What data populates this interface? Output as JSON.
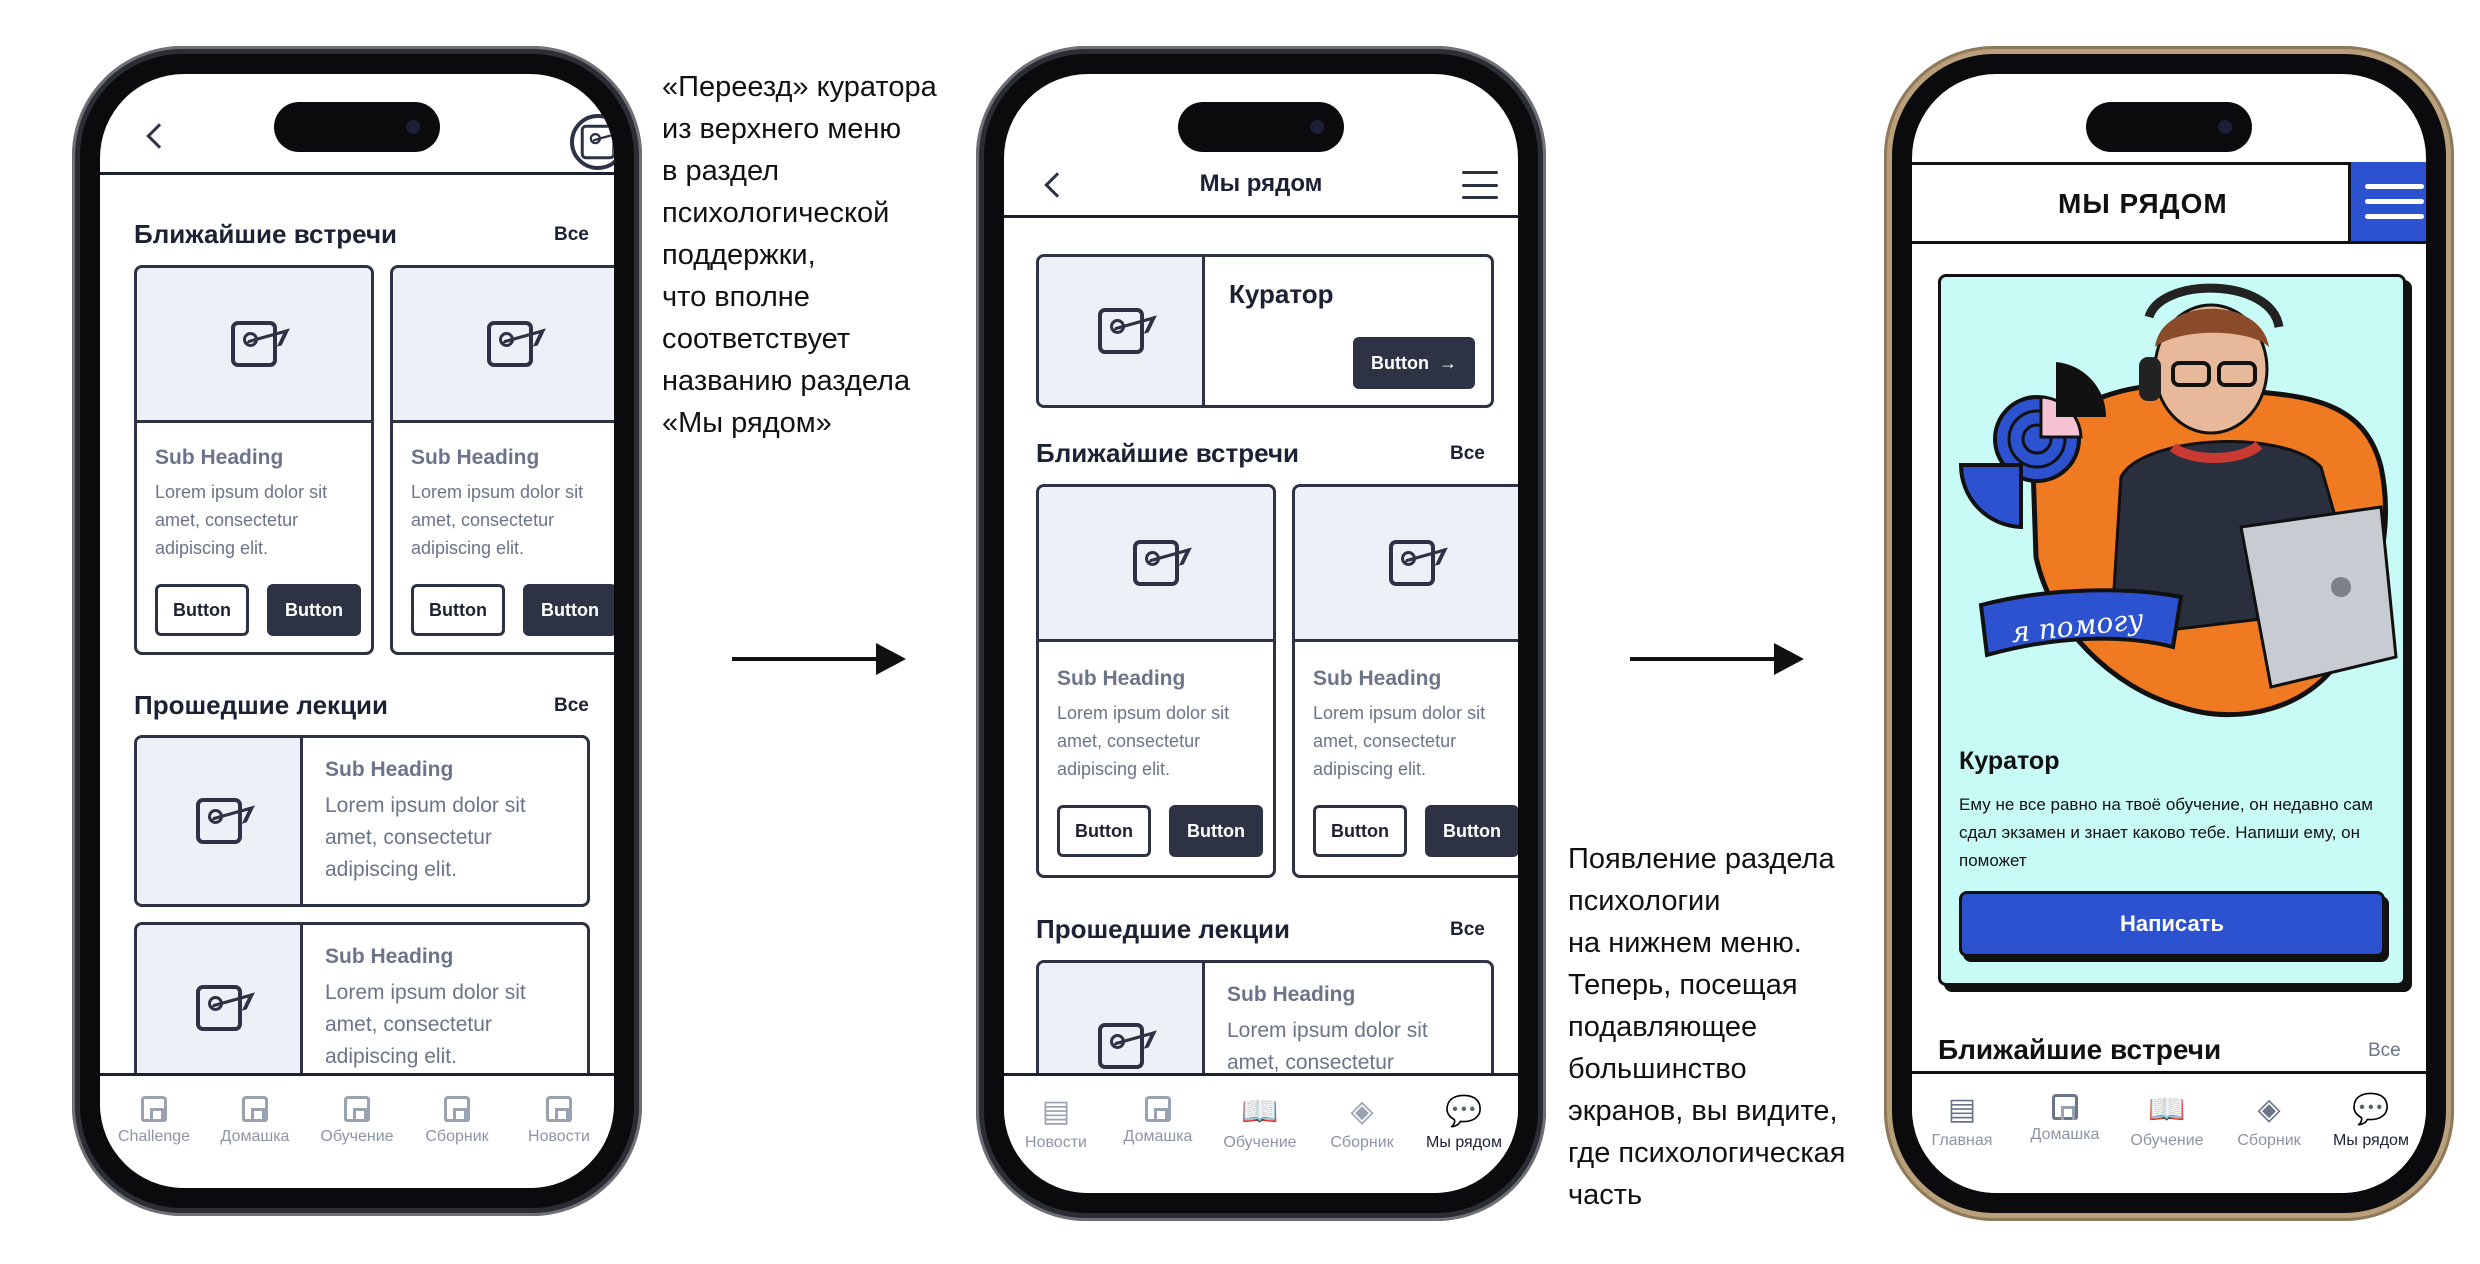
{
  "phone1": {
    "sections": [
      {
        "title": "Ближайшие встречи",
        "see_all": "Все"
      },
      {
        "title": "Прошедшие лекции",
        "see_all": "Все"
      }
    ],
    "cards": {
      "sub_heading": "Sub Heading",
      "body": "Lorem ipsum dolor sit amet, consectetur adipiscing elit.",
      "button_outline": "Button",
      "button_solid": "Button"
    },
    "tabs": [
      "Challenge",
      "Домашка",
      "Обучение",
      "Сборник",
      "Новости"
    ]
  },
  "note1": "«Переезд» куратора\nиз верхнего меню\nв раздел\nпсихологической\nподдержки,\nчто вполне\nсоответствует\nназванию раздела\n«Мы рядом»",
  "phone2": {
    "header_title": "Мы рядом",
    "curator": {
      "title": "Куратор",
      "button": "Button"
    },
    "sections": [
      {
        "title": "Ближайшие встречи",
        "see_all": "Все"
      },
      {
        "title": "Прошедшие лекции",
        "see_all": "Все"
      }
    ],
    "cards": {
      "sub_heading": "Sub Heading",
      "body": "Lorem ipsum dolor sit amet, consectetur adipiscing elit.",
      "button_outline": "Button",
      "button_solid": "Button"
    },
    "tabs": [
      "Новости",
      "Домашка",
      "Обучение",
      "Сборник",
      "Мы рядом"
    ]
  },
  "note2": "Появление раздела\nпсихологии\nна нижнем меню.\nТеперь, посещая\nподавляющее\nбольшинство\nэкранов, вы видите,\nгде психологическая\nчасть",
  "phone3": {
    "header_title": "МЫ РЯДОМ",
    "sticker": "я помогу",
    "curator_title": "Куратор",
    "curator_text": "Ему не все равно на твоё обучение, он недавно сам сдал экзамен и знает каково тебе. Напиши ему, он поможет",
    "cta": "Написать",
    "section_title": "Ближайшие встречи",
    "see_all": "Все",
    "tabs": [
      "Главная",
      "Домашка",
      "Обучение",
      "Сборник",
      "Мы рядом"
    ]
  },
  "colors": {
    "accent_blue": "#2d52d0",
    "mint": "#c9fbf6",
    "orange": "#f07a22",
    "ink": "#2d3344"
  }
}
